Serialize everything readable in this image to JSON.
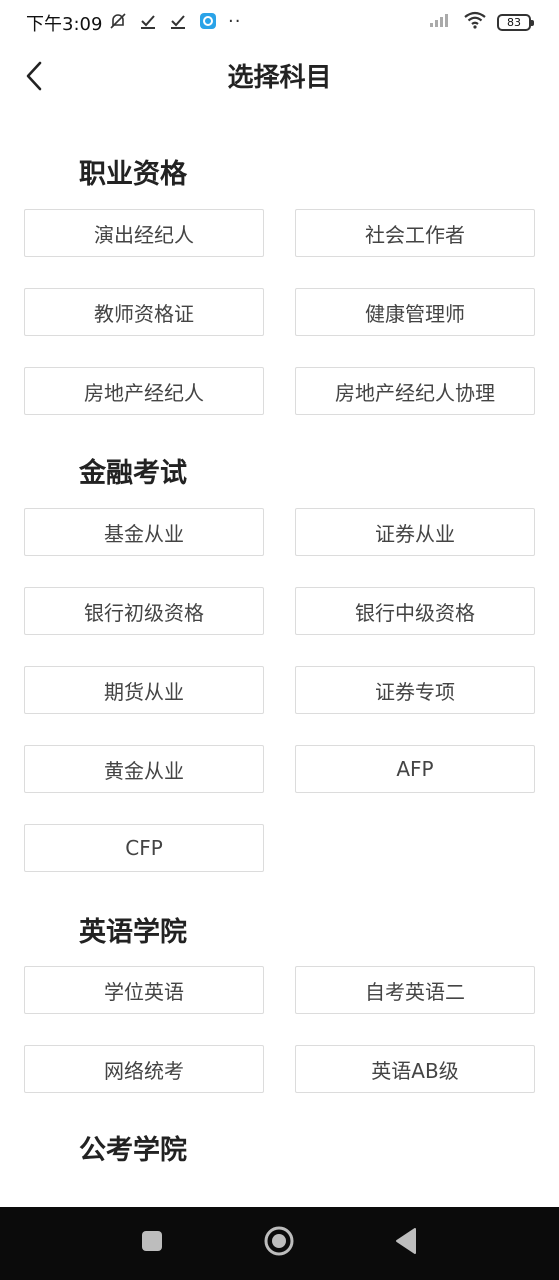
{
  "status": {
    "time": "下午3:09",
    "dots": "··",
    "battery": "83"
  },
  "header": {
    "title": "选择科目"
  },
  "sections": [
    {
      "title": "职业资格",
      "items": [
        "演出经纪人",
        "社会工作者",
        "教师资格证",
        "健康管理师",
        "房地产经纪人",
        "房地产经纪人协理"
      ]
    },
    {
      "title": "金融考试",
      "items": [
        "基金从业",
        "证券从业",
        "银行初级资格",
        "银行中级资格",
        "期货从业",
        "证券专项",
        "黄金从业",
        "AFP",
        "CFP"
      ]
    },
    {
      "title": "英语学院",
      "items": [
        "学位英语",
        "自考英语二",
        "网络统考",
        "英语AB级"
      ]
    },
    {
      "title": "公考学院",
      "items": []
    }
  ],
  "colors": {
    "chip_border": "#dcdcdc",
    "nav_background": "#0b0b0b",
    "text_primary": "#222222"
  }
}
